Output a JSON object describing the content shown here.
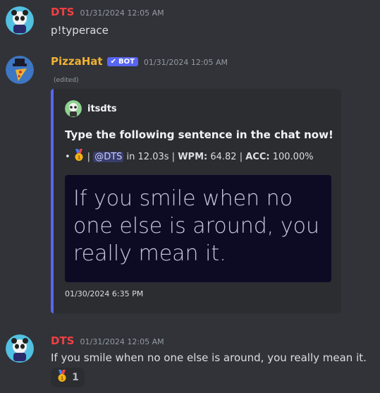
{
  "messages": [
    {
      "username": "DTS",
      "timestamp": "01/31/2024 12:05 AM",
      "content": "p!typerace"
    },
    {
      "username": "PizzaHat",
      "bot_tag": "BOT",
      "timestamp": "01/31/2024 12:05 AM",
      "edited": "(edited)",
      "embed": {
        "author": "itsdts",
        "title": "Type the following sentence in the chat now!",
        "desc_prefix": "•",
        "desc_sep1": "|",
        "mention": "@DTS",
        "desc_time": "in 12.03s",
        "desc_sep2": "|",
        "wpm_label": "WPM:",
        "wpm_value": "64.82",
        "desc_sep3": "|",
        "acc_label": "ACC:",
        "acc_value": "100.00%",
        "image_text": "If you smile when no one else is around, you really mean it.",
        "footer": "01/30/2024 6:35 PM",
        "accent_color": "#5865f2"
      }
    },
    {
      "username": "DTS",
      "timestamp": "01/31/2024 12:05 AM",
      "content": "If you smile when no one else is around, you really mean it.",
      "reaction": {
        "emoji": "first-place-medal-icon",
        "count": "1"
      }
    }
  ],
  "colors": {
    "dts_name": "#f23f43",
    "pizzahat_name": "#f0b232",
    "background": "#313338",
    "embed_bg": "#2b2d31"
  }
}
